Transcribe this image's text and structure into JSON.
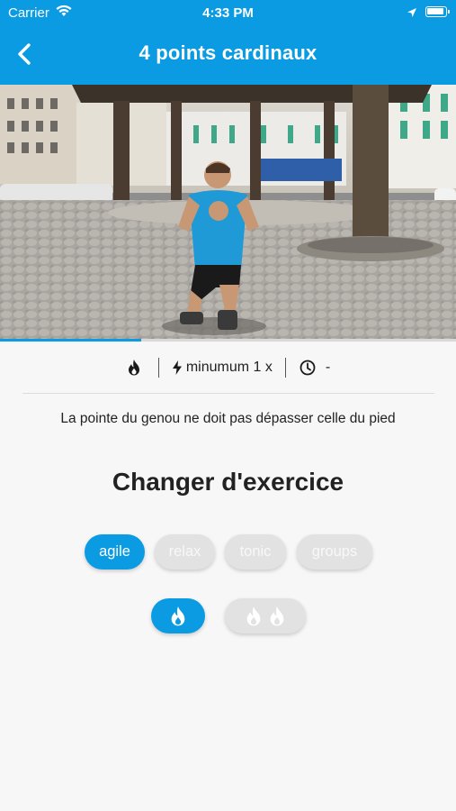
{
  "status_bar": {
    "carrier": "Carrier",
    "time": "4:33 PM"
  },
  "header": {
    "title": "4 points cardinaux",
    "background": "#0b9be3"
  },
  "video": {
    "description_icons": [
      "fire-icon",
      "bolt-icon",
      "clock-icon"
    ],
    "progress": 0.31
  },
  "info": {
    "repetitions": "minumum 1 x",
    "duration": "-"
  },
  "tip": "La pointe du genou ne doit pas dépasser celle du pied",
  "section_title": "Changer d'exercice",
  "categories": [
    {
      "label": "agile",
      "active": true
    },
    {
      "label": "relax",
      "active": false
    },
    {
      "label": "tonic",
      "active": false
    },
    {
      "label": "groups",
      "active": false
    }
  ],
  "levels": [
    {
      "flames": 1,
      "active": true
    },
    {
      "flames": 2,
      "active": false
    }
  ],
  "colors": {
    "accent": "#0b9be3",
    "chip_inactive": "#e2e2e2"
  }
}
